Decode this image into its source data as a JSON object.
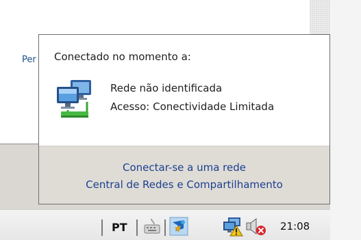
{
  "background": {
    "window_label": "Per"
  },
  "flyout": {
    "connected_label": "Conectado no momento a:",
    "network": {
      "icon": "network-computer-icon",
      "name": "Rede não identificada",
      "access": "Acesso:  Conectividade Limitada"
    },
    "links": {
      "connect": "Conectar-se a uma rede",
      "network_center": "Central de Redes e Compartilhamento"
    }
  },
  "taskbar": {
    "language": "PT",
    "tray_icons": [
      "keyboard-icon",
      "app-tray-icon",
      "network-warning-icon",
      "volume-muted-icon"
    ],
    "clock": "21:08"
  },
  "colors": {
    "link": "#1b3f8f",
    "flyout_footer": "#dfdcd6",
    "warning": "#f0c419",
    "mute_badge": "#d9262b"
  }
}
